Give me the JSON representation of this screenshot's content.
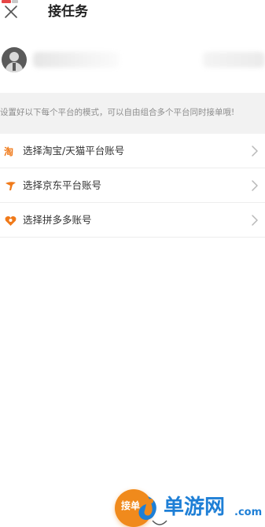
{
  "header": {
    "title": "接任务",
    "close_icon": "close-icon"
  },
  "profile": {
    "avatar_icon": "default-user-avatar"
  },
  "notice": {
    "text": "设置好以下每个平台的模式，可以自由组合多个平台同时接单哦!"
  },
  "accounts": [
    {
      "label": "选择淘宝/天猫平台账号",
      "icon": "taobao-icon",
      "color": "#f07a1a"
    },
    {
      "label": "选择京东平台账号",
      "icon": "jd-icon",
      "color": "#f07a1a"
    },
    {
      "label": "选择拼多多账号",
      "icon": "pinduoduo-icon",
      "color": "#f07a1a"
    }
  ],
  "footer": {
    "accept_label": "接单",
    "accent": "#f08a1c"
  },
  "watermark": {
    "text": "单游网",
    "suffix": ".com",
    "color": "#1e7fd6"
  }
}
